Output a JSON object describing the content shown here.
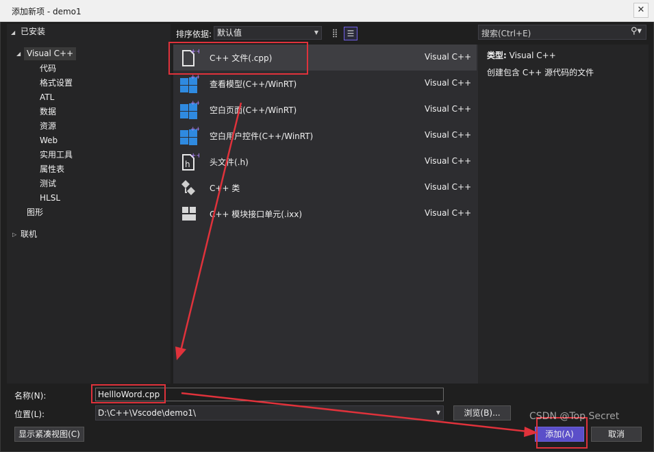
{
  "window": {
    "title": "添加新项 - demo1",
    "close_glyph": "✕"
  },
  "tree": {
    "installed": "已安装",
    "visual_cpp": "Visual C++",
    "children": [
      "代码",
      "格式设置",
      "ATL",
      "数据",
      "资源",
      "Web",
      "实用工具",
      "属性表",
      "测试",
      "HLSL"
    ],
    "graphics": "图形",
    "online": "联机"
  },
  "sort": {
    "label": "排序依据:",
    "value": "默认值"
  },
  "templates": [
    {
      "name": "C++ 文件(.cpp)",
      "lang": "Visual C++",
      "icon": "cpp-file-icon"
    },
    {
      "name": "查看模型(C++/WinRT)",
      "lang": "Visual C++",
      "icon": "winrt-view-model-icon"
    },
    {
      "name": "空白页面(C++/WinRT)",
      "lang": "Visual C++",
      "icon": "winrt-blank-page-icon"
    },
    {
      "name": "空白用户控件(C++/WinRT)",
      "lang": "Visual C++",
      "icon": "winrt-user-control-icon"
    },
    {
      "name": "头文件(.h)",
      "lang": "Visual C++",
      "icon": "header-file-icon"
    },
    {
      "name": "C++ 类",
      "lang": "Visual C++",
      "icon": "cpp-class-icon"
    },
    {
      "name": "C++ 模块接口单元(.ixx)",
      "lang": "Visual C++",
      "icon": "module-interface-icon"
    }
  ],
  "search": {
    "placeholder": "搜索(Ctrl+E)"
  },
  "description": {
    "type_label": "类型:",
    "type_value": "Visual C++",
    "text": "创建包含 C++ 源代码的文件"
  },
  "form": {
    "name_label": "名称(N):",
    "name_value": "HellloWord.cpp",
    "location_label": "位置(L):",
    "location_value": "D:\\C++\\Vscode\\demo1\\",
    "browse": "浏览(B)...",
    "compact_view": "显示紧凑视图(C)",
    "add": "添加(A)",
    "cancel": "取消"
  },
  "watermark": "CSDN @Top Secret",
  "colors": {
    "accent": "#5b4fc9",
    "annotation": "#e0323b",
    "panel": "#2d2d30",
    "icon_blue": "#2f8ae0",
    "icon_purple": "#b286ff"
  }
}
